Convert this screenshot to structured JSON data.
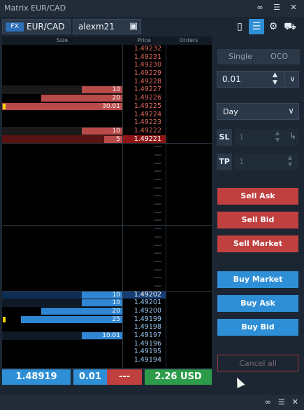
{
  "window": {
    "title": "Matrix EUR/CAD"
  },
  "titlebar_icons": [
    "link-icon",
    "menu-icon",
    "close-icon"
  ],
  "toolbar": {
    "fx_badge": "FX",
    "symbol": "EUR/CAD",
    "account": "alexm21"
  },
  "grid": {
    "headers": {
      "size": "Size",
      "price": "Price",
      "orders": "Orders"
    },
    "empty_price": "---",
    "asks": [
      {
        "price": "1.49232",
        "size": ""
      },
      {
        "price": "1.49231",
        "size": ""
      },
      {
        "price": "1.49230",
        "size": ""
      },
      {
        "price": "1.49229",
        "size": ""
      },
      {
        "price": "1.49228",
        "size": ""
      },
      {
        "price": "1.49227",
        "size": "10"
      },
      {
        "price": "1.49226",
        "size": "20"
      },
      {
        "price": "1.49225",
        "size": "30.01"
      },
      {
        "price": "1.49224",
        "size": ""
      },
      {
        "price": "1.49223",
        "size": ""
      },
      {
        "price": "1.49222",
        "size": "10"
      },
      {
        "price": "1.49221",
        "size": "5"
      }
    ],
    "bids": [
      {
        "price": "1.49202",
        "size": "10"
      },
      {
        "price": "1.49201",
        "size": "10"
      },
      {
        "price": "1.49200",
        "size": "20"
      },
      {
        "price": "1.49199",
        "size": "25"
      },
      {
        "price": "1.49198",
        "size": ""
      },
      {
        "price": "1.49197",
        "size": "10.01"
      },
      {
        "price": "1.49196",
        "size": ""
      },
      {
        "price": "1.49195",
        "size": ""
      },
      {
        "price": "1.49194",
        "size": ""
      }
    ]
  },
  "footer": {
    "last_price": "1.48919",
    "quantity": "0.01",
    "pnl": "---",
    "balance": "2.26 USD"
  },
  "side": {
    "mode_single": "Single",
    "mode_oco": "OCO",
    "quantity": "0.01",
    "tif": "Day",
    "sl_label": "SL",
    "sl_value": "1",
    "tp_label": "TP",
    "tp_value": "1",
    "sell_ask": "Sell Ask",
    "sell_bid": "Sell Bid",
    "sell_market": "Sell Market",
    "buy_market": "Buy Market",
    "buy_ask": "Buy Ask",
    "buy_bid": "Buy Bid",
    "cancel_all": "Cancel all"
  },
  "colors": {
    "ask": "#c0403f",
    "bid": "#2f8fd6",
    "balance": "#2c9b4a"
  }
}
